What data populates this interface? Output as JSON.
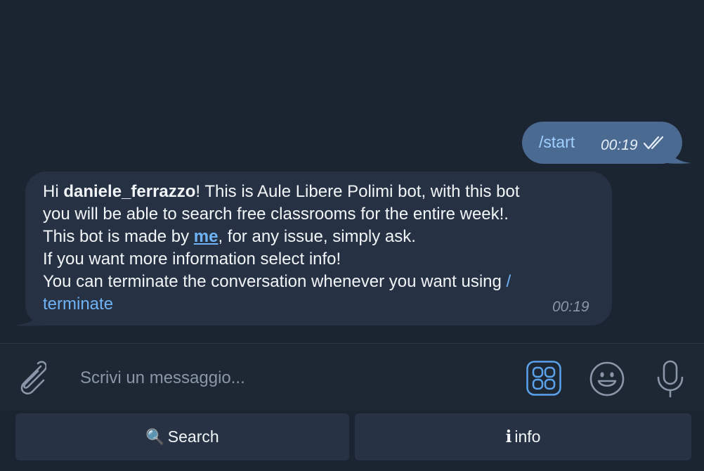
{
  "messages": {
    "outgoing": {
      "text": "/start",
      "time": "00:19"
    },
    "incoming": {
      "greeting_prefix": "Hi ",
      "username": "daniele_ferrazzo",
      "line1_rest": "! This is Aule Libere Polimi bot, with this bot",
      "line2": "you will be able to search free classrooms for the entire week!.",
      "line3_prefix": "This bot is made by ",
      "line3_link": "me",
      "line3_suffix": ", for any issue, simply ask.",
      "line4": "If you want more information select info!",
      "line5_prefix": "You can terminate the conversation whenever you want using ",
      "command_part1": "/",
      "command_part2": "terminate",
      "time": "00:19"
    }
  },
  "input": {
    "placeholder": "Scrivi un messaggio..."
  },
  "bot_keyboard": {
    "search_icon": "🔍",
    "search_label": "Search",
    "info_icon": "i",
    "info_label": "info"
  },
  "colors": {
    "background": "#1b2431",
    "outgoing_bubble": "#4b6a91",
    "incoming_bubble": "#263243",
    "link": "#6fb3f5",
    "keyboard_button": "#273345"
  }
}
